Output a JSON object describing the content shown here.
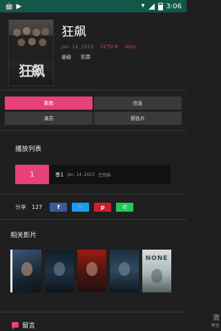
{
  "status_bar": {
    "time": "3:06",
    "icons": [
      "android-icon",
      "play-icon",
      "wifi-icon",
      "signal-icon",
      "battery-icon"
    ]
  },
  "show": {
    "title": "狂飙",
    "date": "Jan. 14, 2023",
    "channel": "CCTV-8",
    "platform": "iQiyi",
    "genres": [
      "悬疑",
      "犯罪"
    ],
    "poster_text": "狂飙"
  },
  "tabs": [
    {
      "label": "集数",
      "active": true
    },
    {
      "label": "信息",
      "active": false
    },
    {
      "label": "演员",
      "active": false
    },
    {
      "label": "预告片",
      "active": false
    }
  ],
  "playlist": {
    "title": "播放列表",
    "episodes": [
      {
        "number": "1",
        "season": "季1",
        "date": "Jan. 14, 2023",
        "status": "已完結"
      }
    ]
  },
  "share": {
    "label": "分享",
    "count": "127",
    "buttons": [
      {
        "name": "facebook",
        "glyph": "f"
      },
      {
        "name": "twitter",
        "glyph": "🐦"
      },
      {
        "name": "pinterest",
        "glyph": "p"
      },
      {
        "name": "whatsapp",
        "glyph": "✆"
      }
    ]
  },
  "related": {
    "title": "相关影片",
    "items": [
      "",
      "",
      "",
      "",
      "NONE"
    ]
  },
  "comments": {
    "label": "留言"
  },
  "watermark": {
    "line1": "激",
    "line2": "转至"
  },
  "colors": {
    "accent": "#e8417a",
    "status_bar": "#13574a",
    "background": "#1f1f1f"
  }
}
